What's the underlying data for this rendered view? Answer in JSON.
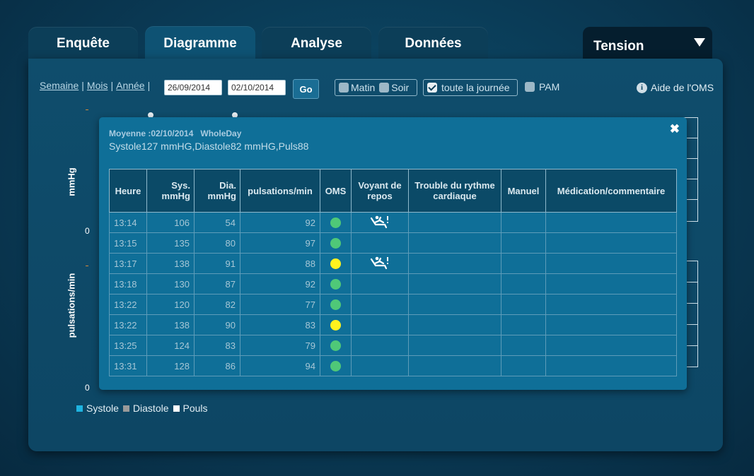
{
  "tabs": {
    "enquete": "Enquête",
    "diagramme": "Diagramme",
    "analyse": "Analyse",
    "donnees": "Données",
    "tension": "Tension"
  },
  "toolbar": {
    "semaine": "Semaine",
    "mois": "Mois",
    "annee": "Année",
    "sep": "|",
    "date_from": "26/09/2014",
    "date_to": "02/10/2014",
    "go": "Go",
    "matin": "Matin",
    "soir": "Soir",
    "toute_journee": "toute la journée",
    "toute_journee_checked": true,
    "pam": "PAM",
    "aide": "Aide de l'OMS"
  },
  "chart": {
    "ylabel_top": "mmHg",
    "ylabel_bottom": "pulsations/min",
    "zero_top": "0",
    "zero_bottom": "0"
  },
  "legend": {
    "systole": "Systole",
    "diastole": "Diastole",
    "pouls": "Pouls",
    "colors": {
      "systole": "#1eb3e0",
      "diastole": "#9a9a9a",
      "pouls": "#ffffff"
    }
  },
  "popup": {
    "title": "Moyenne :02/10/2014   WholeDay",
    "subtitle": "Systole127 mmHG,Diastole82 mmHG,Puls88",
    "columns": {
      "heure": "Heure",
      "sys": "Sys. mmHg",
      "dia": "Dia. mmHg",
      "puls": "pulsations/min",
      "oms": "OMS",
      "voyant": "Voyant de repos",
      "trouble": "Trouble du rythme cardiaque",
      "manuel": "Manuel",
      "medication": "Médication/commentaire"
    },
    "oms_colors": {
      "green": "#4fc878",
      "yellow": "#fff21e"
    },
    "rows": [
      {
        "heure": "13:14",
        "sys": "106",
        "dia": "54",
        "puls": "92",
        "oms": "green",
        "repos": true
      },
      {
        "heure": "13:15",
        "sys": "135",
        "dia": "80",
        "puls": "97",
        "oms": "green",
        "repos": false
      },
      {
        "heure": "13:17",
        "sys": "138",
        "dia": "91",
        "puls": "88",
        "oms": "yellow",
        "repos": true
      },
      {
        "heure": "13:18",
        "sys": "130",
        "dia": "87",
        "puls": "92",
        "oms": "green",
        "repos": false
      },
      {
        "heure": "13:22",
        "sys": "120",
        "dia": "82",
        "puls": "77",
        "oms": "green",
        "repos": false
      },
      {
        "heure": "13:22",
        "sys": "138",
        "dia": "90",
        "puls": "83",
        "oms": "yellow",
        "repos": false
      },
      {
        "heure": "13:25",
        "sys": "124",
        "dia": "83",
        "puls": "79",
        "oms": "green",
        "repos": false
      },
      {
        "heure": "13:31",
        "sys": "128",
        "dia": "86",
        "puls": "94",
        "oms": "green",
        "repos": false
      }
    ]
  }
}
